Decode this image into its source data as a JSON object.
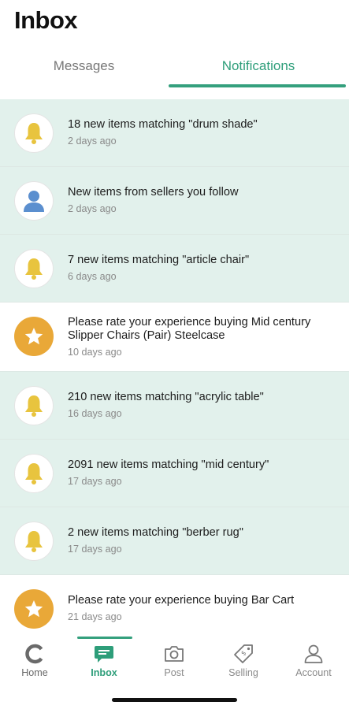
{
  "header": {
    "title": "Inbox"
  },
  "tabs": [
    {
      "label": "Messages",
      "active": false
    },
    {
      "label": "Notifications",
      "active": true
    }
  ],
  "colors": {
    "accent": "#34a07d",
    "unread_bg": "#e2f1ec",
    "bell": "#e8c43e",
    "gold": "#e9a838",
    "person": "#5b8fcf"
  },
  "notifications": [
    {
      "icon": "bell-icon",
      "message": "18 new items matching \"drum shade\"",
      "time": "2 days ago",
      "unread": true
    },
    {
      "icon": "person-icon",
      "message": "New items from sellers you follow",
      "time": "2 days ago",
      "unread": true
    },
    {
      "icon": "bell-icon",
      "message": "7 new items matching \"article chair\"",
      "time": "6 days ago",
      "unread": true
    },
    {
      "icon": "star-icon",
      "message": "Please rate your experience buying Mid century Slipper Chairs (Pair) Steelcase",
      "time": "10 days ago",
      "unread": false
    },
    {
      "icon": "bell-icon",
      "message": "210 new items matching \"acrylic table\"",
      "time": "16 days ago",
      "unread": true
    },
    {
      "icon": "bell-icon",
      "message": "2091 new items matching \"mid century\"",
      "time": "17 days ago",
      "unread": true
    },
    {
      "icon": "bell-icon",
      "message": "2 new items matching \"berber rug\"",
      "time": "17 days ago",
      "unread": true
    },
    {
      "icon": "star-icon",
      "message": "Please rate your experience buying Bar Cart",
      "time": "21 days ago",
      "unread": false
    }
  ],
  "bottom_nav": [
    {
      "label": "Home",
      "icon": "home-logo-icon",
      "active": false
    },
    {
      "label": "Inbox",
      "icon": "chat-icon",
      "active": true
    },
    {
      "label": "Post",
      "icon": "camera-icon",
      "active": false
    },
    {
      "label": "Selling",
      "icon": "price-tag-icon",
      "active": false
    },
    {
      "label": "Account",
      "icon": "person-outline-icon",
      "active": false
    }
  ]
}
